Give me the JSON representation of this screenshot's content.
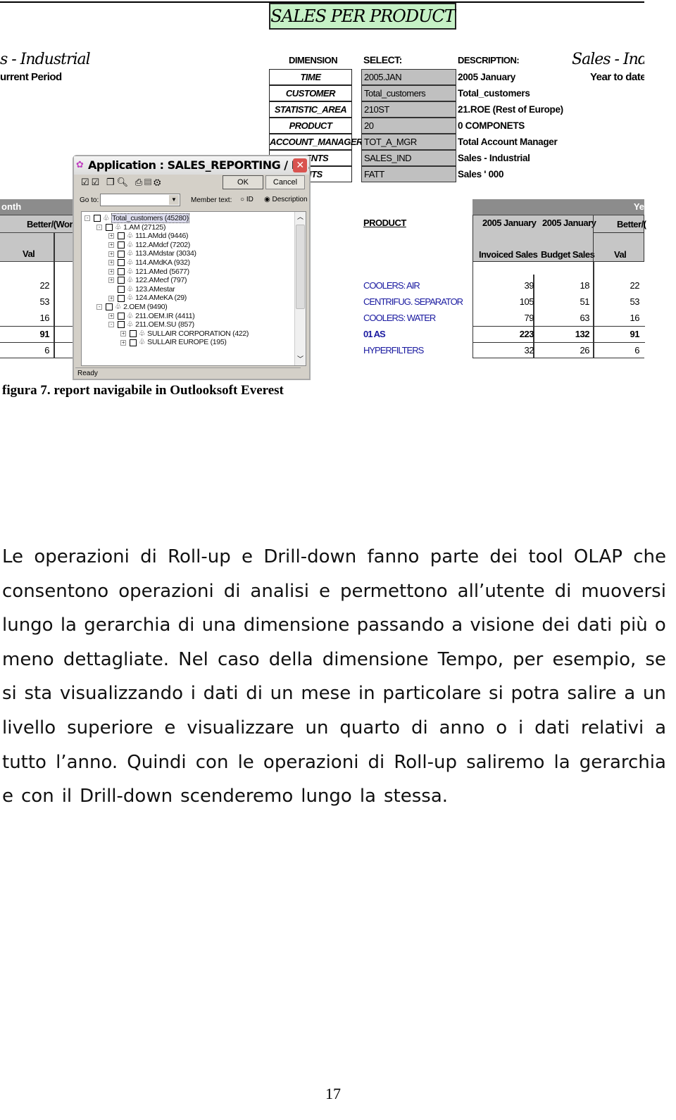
{
  "report": {
    "banner": "SALES PER PRODUCT",
    "left_title": "s - Industrial",
    "left_subtitle": "urrent Period",
    "right_title": "Sales - Indust",
    "right_subtitle": "Year to date",
    "headers": {
      "dimension": "DIMENSION",
      "select": "SELECT:",
      "description": "DESCRIPTION:"
    },
    "dimensions": [
      {
        "name": "TIME",
        "select": "2005.JAN",
        "description": "2005 January"
      },
      {
        "name": "CUSTOMER",
        "select": "Total_customers",
        "description": "Total_customers"
      },
      {
        "name": "STATISTIC_AREA",
        "select": "210ST",
        "description": "21.ROE (Rest of Europe)"
      },
      {
        "name": "PRODUCT",
        "select": "20",
        "description": "0 COMPONETS"
      },
      {
        "name": "ACCOUNT_MANAGER",
        "select": "TOT_A_MGR",
        "description": "Total Account Manager"
      },
      {
        "name": "TMENTS",
        "select": "SALES_IND",
        "description": "Sales - Industrial"
      },
      {
        "name": "UNTS",
        "select": "FATT",
        "description": "Sales ' 000"
      }
    ],
    "left_table": {
      "bar": "onth",
      "header": "Better/(Wors",
      "col": "Val",
      "values": [
        "22",
        "53",
        "16",
        "91",
        "6"
      ]
    },
    "product_label": "PRODUCT",
    "right_table": {
      "bar": "Ye",
      "col1_top": "2005 January",
      "col2_top": "2005 January",
      "col3_top": "Better/(",
      "col1": "Invoiced Sales",
      "col2": "Budget Sales",
      "col3": "Val"
    },
    "rows": [
      {
        "product": "COOLERS: AIR",
        "invoiced": "39",
        "budget": "18",
        "val": "22"
      },
      {
        "product": "CENTRIFUG. SEPARATOR",
        "invoiced": "105",
        "budget": "51",
        "val": "53"
      },
      {
        "product": "COOLERS: WATER",
        "invoiced": "79",
        "budget": "63",
        "val": "16"
      },
      {
        "product": "01 AS",
        "invoiced": "223",
        "budget": "132",
        "val": "91"
      },
      {
        "product": "HYPERFILTERS",
        "invoiced": "32",
        "budget": "26",
        "val": "6"
      }
    ]
  },
  "dialog": {
    "title": "Application : SALES_REPORTING / Di...",
    "ok": "OK",
    "cancel": "Cancel",
    "goto_label": "Go to:",
    "member_text": "Member text:",
    "radio_id": "ID",
    "radio_desc": "Description",
    "status": "Ready",
    "tree": [
      {
        "label": "Total_customers (45280)",
        "level": 0,
        "toggle": "-"
      },
      {
        "label": "1.AM (27125)",
        "level": 1,
        "toggle": "-"
      },
      {
        "label": "111.AMdd (9446)",
        "level": 2,
        "toggle": "+"
      },
      {
        "label": "112.AMdcf (7202)",
        "level": 2,
        "toggle": "+"
      },
      {
        "label": "113.AMdstar (3034)",
        "level": 2,
        "toggle": "+"
      },
      {
        "label": "114.AMdKA (932)",
        "level": 2,
        "toggle": "+"
      },
      {
        "label": "121.AMed (5677)",
        "level": 2,
        "toggle": "+"
      },
      {
        "label": "122.AMecf (797)",
        "level": 2,
        "toggle": "+"
      },
      {
        "label": "123.AMestar",
        "level": 2,
        "toggle": ""
      },
      {
        "label": "124.AMeKA (29)",
        "level": 2,
        "toggle": "+"
      },
      {
        "label": "2.OEM (9490)",
        "level": 1,
        "toggle": "-"
      },
      {
        "label": "211.OEM.IR (4411)",
        "level": 2,
        "toggle": "+"
      },
      {
        "label": "211.OEM.SU (857)",
        "level": 2,
        "toggle": "-"
      },
      {
        "label": "SULLAIR CORPORATION (422)",
        "level": 3,
        "toggle": "+"
      },
      {
        "label": "SULLAIR EUROPE (195)",
        "level": 3,
        "toggle": "+"
      }
    ]
  },
  "caption": "figura 7. report navigabile in Outlooksoft Everest",
  "body_lines": [
    "Le operazioni di Roll-up e Drill-down fanno parte dei tool OLAP che",
    "consentono operazioni di analisi e permettono all’utente di muoversi",
    "lungo la gerarchia di una dimensione passando a visione dei dati più o",
    "meno dettagliate. Nel caso della dimensione Tempo, per esempio, se",
    "si sta visualizzando i dati di un mese in particolare si potra salire a un",
    "livello superiore e visualizzare un quarto di anno o i dati relativi a",
    "tutto l’anno. Quindi con le operazioni di Roll-up saliremo la gerarchia",
    "e con il Drill-down scenderemo lungo la stessa."
  ],
  "page_number": "17"
}
